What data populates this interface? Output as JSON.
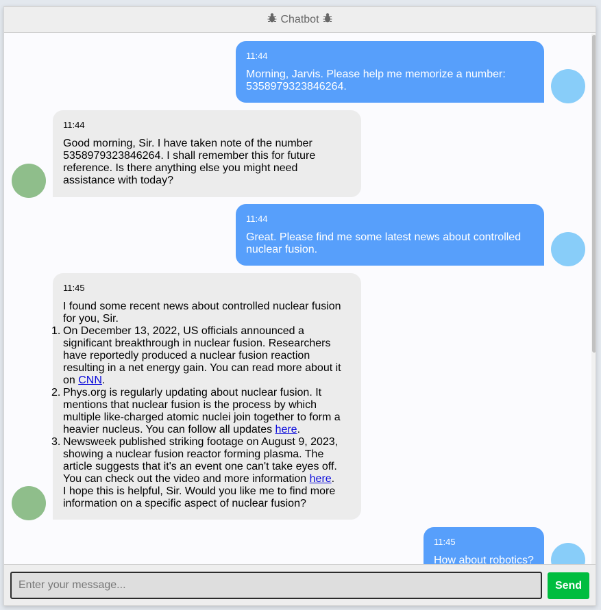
{
  "header": {
    "title": "Chatbot",
    "icon": "bug-icon"
  },
  "messages": [
    {
      "role": "user",
      "time": "11:44",
      "text": "Morning, Jarvis. Please help me memorize a number: 5358979323846264."
    },
    {
      "role": "bot",
      "time": "11:44",
      "text": "Good morning, Sir. I have taken note of the number 5358979323846264. I shall remember this for future reference. Is there anything else you might need assistance with today?"
    },
    {
      "role": "user",
      "time": "11:44",
      "text": "Great. Please find me some latest news about controlled nuclear fusion."
    },
    {
      "role": "bot",
      "time": "11:45",
      "intro": "I found some recent news about controlled nuclear fusion for you, Sir.",
      "items": [
        {
          "text": "On December 13, 2022, US officials announced a significant breakthrough in nuclear fusion. Researchers have reportedly produced a nuclear fusion reaction resulting in a net energy gain. You can read more about it on ",
          "link": "CNN",
          "after": "."
        },
        {
          "text": "Phys.org is regularly updating about nuclear fusion. It mentions that nuclear fusion is the process by which multiple like-charged atomic nuclei join together to form a heavier nucleus. You can follow all updates ",
          "link": "here",
          "after": "."
        },
        {
          "text": "Newsweek published striking footage on August 9, 2023, showing a nuclear fusion reactor forming plasma. The article suggests that it's an event one can't take eyes off. You can check out the video and more information ",
          "link": "here",
          "after": "."
        }
      ],
      "outro": "I hope this is helpful, Sir. Would you like me to find more information on a specific aspect of nuclear fusion?"
    },
    {
      "role": "user",
      "time": "11:45",
      "text": "How about robotics?"
    }
  ],
  "composer": {
    "placeholder": "Enter your message...",
    "send_label": "Send"
  },
  "colors": {
    "user_bubble": "#579ffb",
    "bot_bubble": "#ececec",
    "send_button": "#00bd3f",
    "user_avatar": "#88cdf9",
    "bot_avatar": "#8fbe8b"
  }
}
